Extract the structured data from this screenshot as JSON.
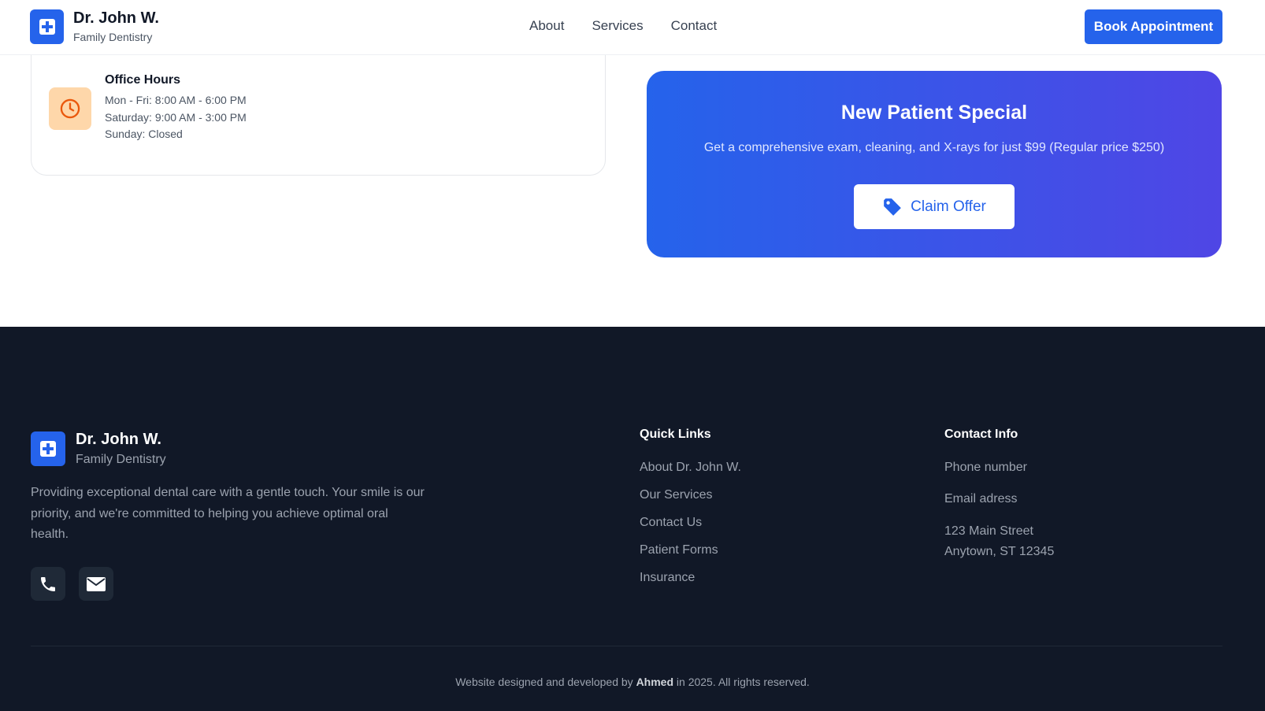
{
  "header": {
    "brand_name": "Dr. John W.",
    "brand_sub": "Family Dentistry",
    "nav": [
      "About",
      "Services",
      "Contact"
    ],
    "book_button": "Book Appointment"
  },
  "hours": {
    "title": "Office Hours",
    "lines": [
      "Mon - Fri: 8:00 AM - 6:00 PM",
      "Saturday: 9:00 AM - 3:00 PM",
      "Sunday: Closed"
    ]
  },
  "promo": {
    "title": "New Patient Special",
    "text": "Get a comprehensive exam, cleaning, and X-rays for just $99 (Regular price $250)",
    "button": "Claim Offer"
  },
  "footer": {
    "brand_name": "Dr. John W.",
    "brand_sub": "Family Dentistry",
    "description": "Providing exceptional dental care with a gentle touch. Your smile is our priority, and we're committed to helping you achieve optimal oral health.",
    "quick_links_title": "Quick Links",
    "quick_links": [
      "About Dr. John W.",
      "Our Services",
      "Contact Us",
      "Patient Forms",
      "Insurance"
    ],
    "contact_title": "Contact Info",
    "phone": "Phone number",
    "email": "Email adress",
    "address_line1": "123 Main Street",
    "address_line2": "Anytown, ST 12345",
    "copyright_pre": "Website designed and developed by",
    "copyright_author": "Ahmed",
    "copyright_post": "in 2025. All rights reserved."
  },
  "colors": {
    "primary": "#2563eb",
    "footer_bg": "#111827",
    "promo_gradient_end": "#4f46e5",
    "hours_icon_bg": "#fed7aa"
  },
  "icons": [
    "medical-cross-icon",
    "clock-icon",
    "tag-icon",
    "phone-icon",
    "mail-icon"
  ]
}
